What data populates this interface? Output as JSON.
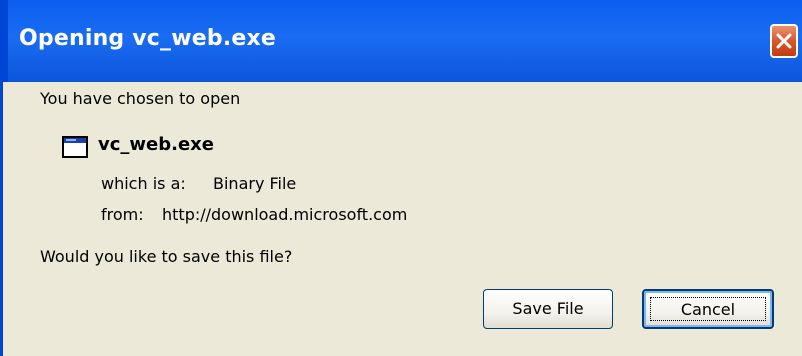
{
  "window": {
    "title": "Opening vc_web.exe",
    "close_icon": "close-icon"
  },
  "dialog": {
    "intro": "You have chosen to open",
    "file_icon": "application-window-icon",
    "file_name": "vc_web.exe",
    "type_label": "which is a:",
    "type_value": "Binary File",
    "from_label": "from:",
    "from_value": "http://download.microsoft.com",
    "question": "Would you like to save this file?"
  },
  "buttons": {
    "save_label": "Save File",
    "cancel_label": "Cancel"
  },
  "colors": {
    "titlebar": "#0a5ef0",
    "close_button": "#d8572e",
    "dialog_background": "#ece9d8",
    "button_border": "#003c74"
  }
}
